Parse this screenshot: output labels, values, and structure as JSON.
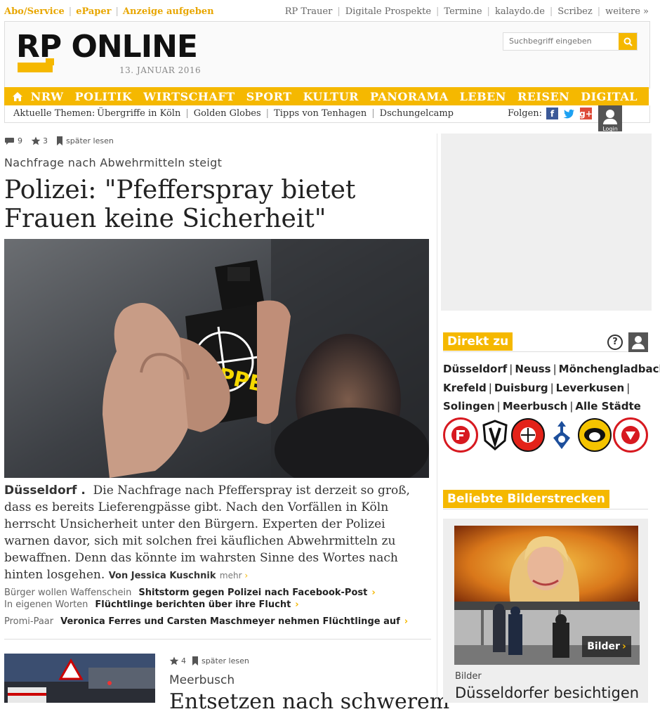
{
  "service_links": {
    "abo": "Abo/Service",
    "epaper": "ePaper",
    "anzeige": "Anzeige aufgeben"
  },
  "top_links": [
    "RP Trauer",
    "Digitale Prospekte",
    "Termine",
    "kalaydo.de",
    "Scribez",
    "weitere »"
  ],
  "logo": "RP ONLINE",
  "date": "13. JANUAR 2016",
  "search": {
    "placeholder": "Suchbegriff eingeben"
  },
  "nav": [
    "NRW",
    "POLITIK",
    "WIRTSCHAFT",
    "SPORT",
    "KULTUR",
    "PANORAMA",
    "LEBEN",
    "REISEN",
    "DIGITAL"
  ],
  "topics": {
    "label": "Aktuelle Themen:",
    "items": [
      "Übergriffe in Köln",
      "Golden Globes",
      "Tipps von Tenhagen",
      "Dschungelcamp"
    ],
    "follow_label": "Folgen:"
  },
  "login_label": "Login",
  "article": {
    "comments": "9",
    "stars": "3",
    "read_later": "später lesen",
    "kicker": "Nachfrage nach Abwehrmitteln steigt",
    "headline": "Polizei: \"Pfefferspray bietet Frauen keine Sicherheit\"",
    "image_text": "PEPPER",
    "city": "Düsseldorf",
    "body": "Die Nachfrage nach Pfefferspray ist derzeit so groß, dass es bereits Lieferengpässe gibt. Nach den Vorfällen in Köln herrscht Unsicherheit unter den Bürgern. Experten der Polizei warnen davor, sich mit solchen frei käuflichen Abwehrmitteln zu bewaffnen. Denn das könnte im wahrsten Sinne des Wortes nach hinten losgehen.",
    "author": "Von Jessica Kuschnik",
    "more": "mehr"
  },
  "related": [
    {
      "kicker": "Bürger wollen Waffenschein",
      "title": "Shitstorm gegen Polizei nach Facebook-Post"
    },
    {
      "kicker": "In eigenen Worten",
      "title": "Flüchtlinge berichten über ihre Flucht"
    },
    {
      "kicker": "Promi-Paar",
      "title": "Veronica Ferres und Carsten Maschmeyer nehmen Flüchtlinge auf"
    }
  ],
  "article2": {
    "stars": "4",
    "read_later": "später lesen",
    "kicker": "Meerbusch",
    "headline": "Entsetzen nach schwerem"
  },
  "direkt": {
    "title": "Direkt zu",
    "cities": [
      "Düsseldorf",
      "Neuss",
      "Mönchengladbach",
      "Krefeld",
      "Duisburg",
      "Leverkusen",
      "Solingen",
      "Meerbusch",
      "Alle Städte"
    ]
  },
  "clubs": [
    "Fortuna Düsseldorf",
    "Borussia Mönchengladbach",
    "Bayer Leverkusen",
    "MSV Duisburg",
    "KEV Krefeld",
    "DEG"
  ],
  "gallery": {
    "title": "Beliebte Bilderstrecken",
    "button": "Bilder",
    "kicker": "Bilder",
    "headline": "Düsseldorfer besichtigen"
  },
  "colors": {
    "accent": "#f5b800",
    "text": "#222222"
  }
}
